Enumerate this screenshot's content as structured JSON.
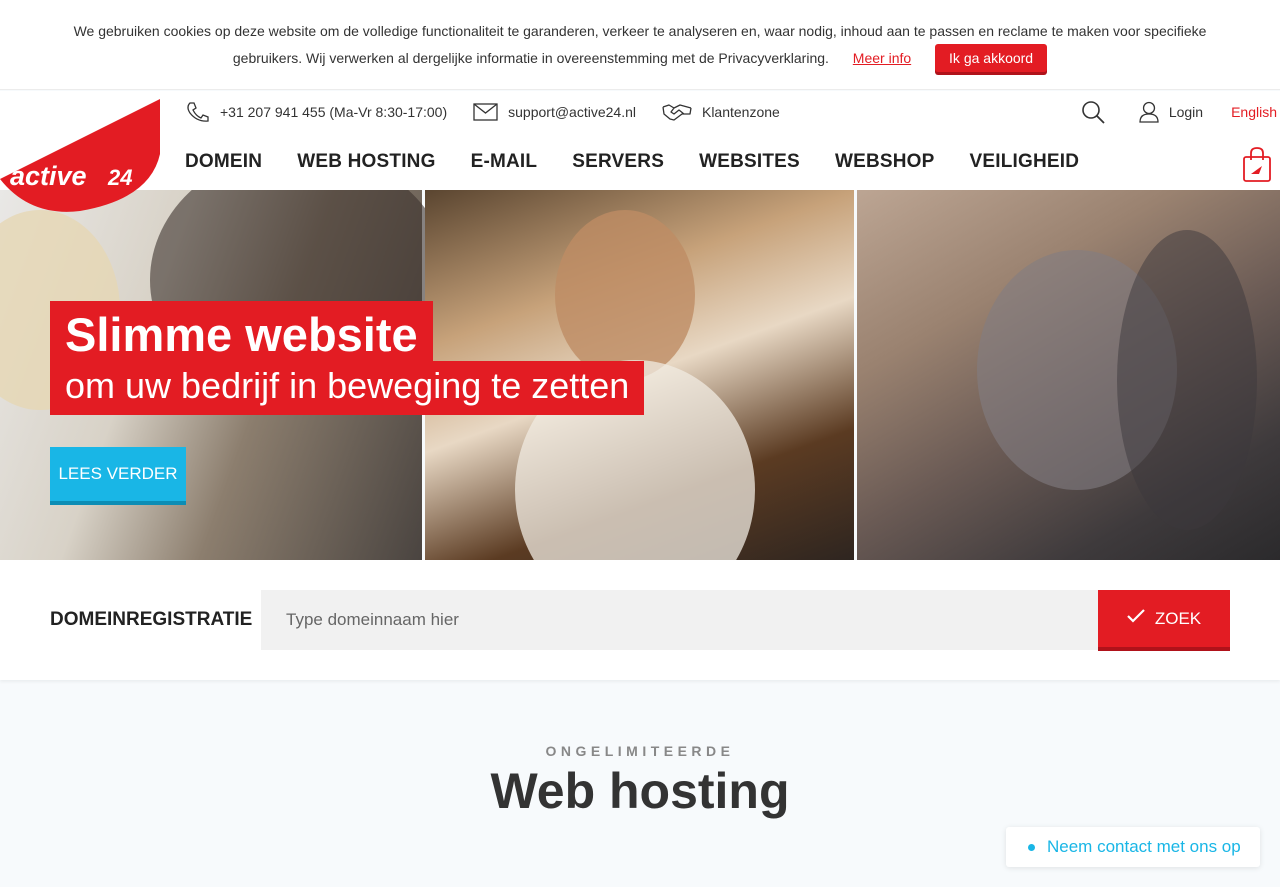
{
  "cookie": {
    "message": "We gebruiken cookies op deze website om de volledige functionaliteit te garanderen, verkeer te analyseren en, waar nodig, inhoud aan te passen en reclame te maken voor specifieke gebruikers. Wij verwerken al dergelijke informatie in overeenstemming met de Privacyverklaring.",
    "more_label": "Meer info",
    "accept_label": "Ik ga akkoord"
  },
  "header": {
    "logo_text": "active",
    "logo_num": "24",
    "phone": "+31 207 941 455 (Ma-Vr 8:30-17:00)",
    "email": "support@active24.nl",
    "client_zone": "Klantenzone",
    "login": "Login",
    "language": "English",
    "nav": [
      "DOMEIN",
      "WEB HOSTING",
      "E-MAIL",
      "SERVERS",
      "WEBSITES",
      "WEBSHOP",
      "VEILIGHEID"
    ]
  },
  "hero": {
    "title": "Slimme website",
    "subtitle": "om uw bedrijf in beweging te zetten",
    "button": "LEES VERDER"
  },
  "domain": {
    "label": "DOMEINREGISTRATIE",
    "placeholder": "Type domeinnaam hier",
    "button": "ZOEK"
  },
  "section": {
    "kicker": "ONGELIMITEERDE",
    "title": "Web hosting"
  },
  "contact": {
    "label": "Neem contact met ons op"
  },
  "colors": {
    "brand_red": "#e31c23",
    "accent_blue": "#19b6e6"
  }
}
